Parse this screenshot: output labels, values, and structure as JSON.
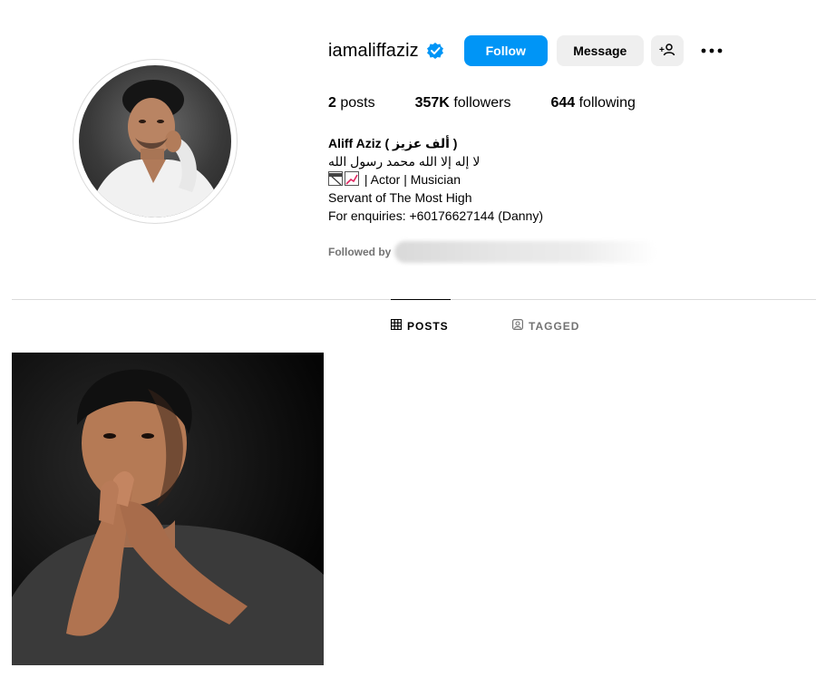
{
  "profile": {
    "username": "iamaliffaziz",
    "verified": true,
    "avatar_alt": "",
    "buttons": {
      "follow": "Follow",
      "message": "Message",
      "suggest_icon": "add-person-icon",
      "more_icon": "more-options-icon"
    }
  },
  "stats": {
    "posts_count": "2",
    "posts_label": "posts",
    "followers_count": "357K",
    "followers_label": "followers",
    "following_count": "644",
    "following_label": "following"
  },
  "bio": {
    "name": "Aliff Aziz",
    "name_arabic": "( ألف عزيز )",
    "line_shahada": "لا إله إلا الله محمد رسول الله",
    "line_roles": "| Actor | Musician",
    "line_servant": "Servant of The Most High",
    "line_enquiries": "For enquiries: +60176627144 (Danny)"
  },
  "followed_by": {
    "label": "Followed by"
  },
  "tabs": [
    {
      "label": "POSTS",
      "icon": "grid-icon",
      "active": true
    },
    {
      "label": "TAGGED",
      "icon": "tagged-icon",
      "active": false
    }
  ],
  "colors": {
    "follow_button": "#0095f6",
    "secondary_button": "#efefef",
    "muted_text": "#737373",
    "divider": "#dbdbdb"
  }
}
